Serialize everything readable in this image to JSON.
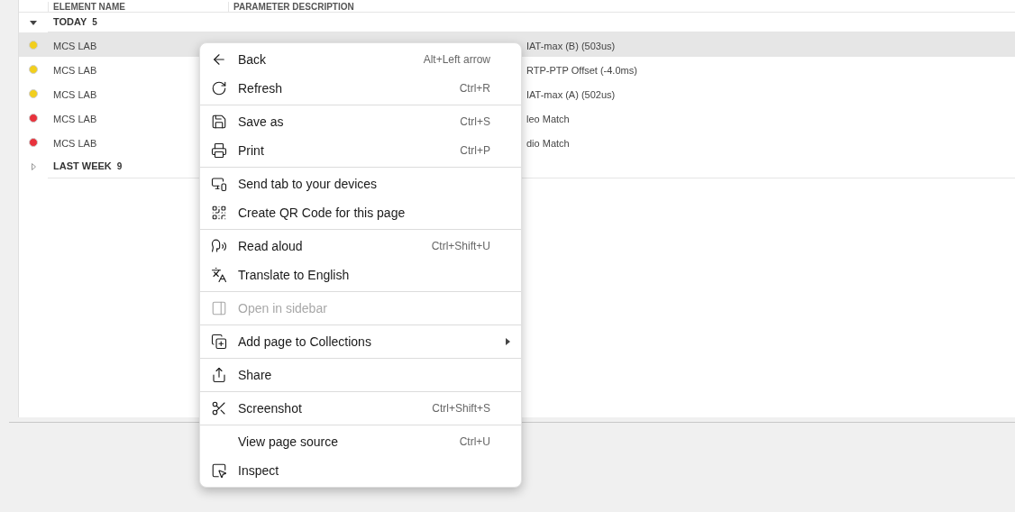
{
  "table": {
    "columns": [
      "ELEMENT NAME",
      "PARAMETER DESCRIPTION"
    ],
    "groups": [
      {
        "label": "TODAY",
        "count": "5",
        "expanded": true,
        "rows": [
          {
            "element": "MCS LAB",
            "description": "IAT-max (B) (503us)",
            "color": "#f2cf1d",
            "selected": true
          },
          {
            "element": "MCS LAB",
            "description": "RTP-PTP Offset (-4.0ms)",
            "color": "#f2cf1d",
            "selected": false
          },
          {
            "element": "MCS LAB",
            "description": "IAT-max (A) (502us)",
            "color": "#f2cf1d",
            "selected": false
          },
          {
            "element": "MCS LAB",
            "description": "leo Match",
            "color": "#e8323c",
            "selected": false
          },
          {
            "element": "MCS LAB",
            "description": "dio Match",
            "color": "#e8323c",
            "selected": false
          }
        ]
      },
      {
        "label": "LAST WEEK",
        "count": "9",
        "expanded": false
      }
    ]
  },
  "context_menu": {
    "sections": [
      [
        {
          "label": "Back",
          "shortcut": "Alt+Left arrow",
          "disabled": false
        },
        {
          "label": "Refresh",
          "shortcut": "Ctrl+R",
          "disabled": false
        }
      ],
      [
        {
          "label": "Save as",
          "shortcut": "Ctrl+S",
          "disabled": false
        },
        {
          "label": "Print",
          "shortcut": "Ctrl+P",
          "disabled": false
        }
      ],
      [
        {
          "label": "Send tab to your devices",
          "disabled": false
        },
        {
          "label": "Create QR Code for this page",
          "disabled": false
        }
      ],
      [
        {
          "label": "Read aloud",
          "shortcut": "Ctrl+Shift+U",
          "disabled": false
        },
        {
          "label": "Translate to English",
          "disabled": false
        }
      ],
      [
        {
          "label": "Open in sidebar",
          "disabled": true
        }
      ],
      [
        {
          "label": "Add page to Collections",
          "disabled": false,
          "submenu": true
        }
      ],
      [
        {
          "label": "Share",
          "disabled": false
        }
      ],
      [
        {
          "label": "Screenshot",
          "shortcut": "Ctrl+Shift+S",
          "disabled": false
        }
      ],
      [
        {
          "label": "View page source",
          "shortcut": "Ctrl+U",
          "disabled": false
        },
        {
          "label": "Inspect",
          "disabled": false
        }
      ]
    ]
  }
}
